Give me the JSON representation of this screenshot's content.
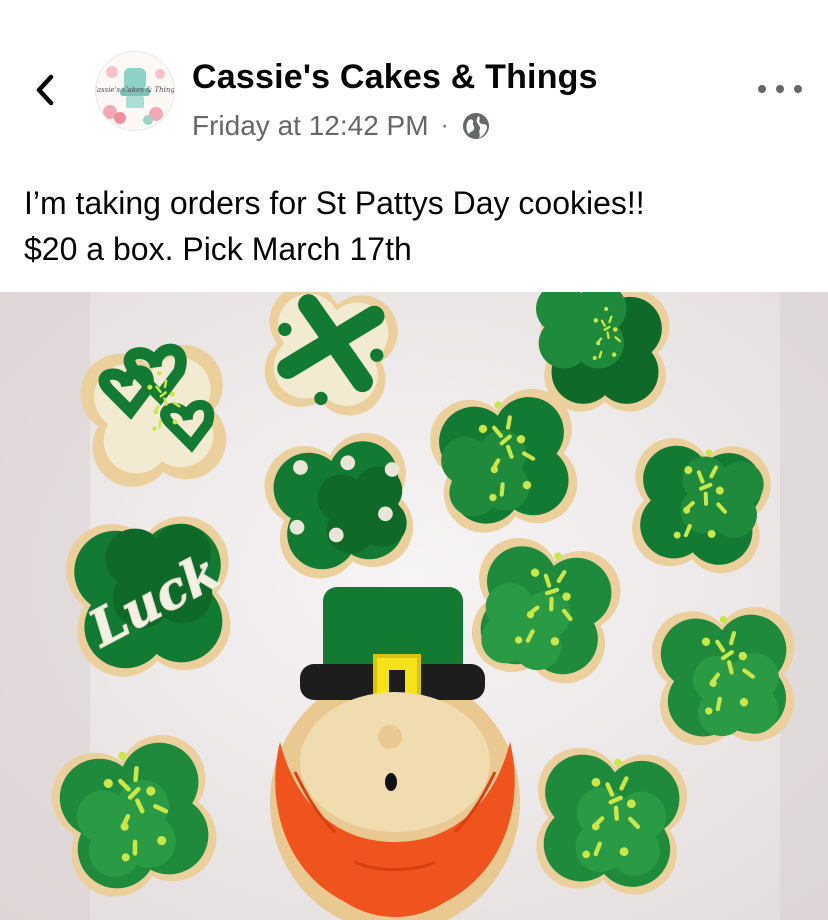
{
  "post": {
    "page_name": "Cassie's Cakes & Things",
    "timestamp": "Friday at 12:42 PM",
    "separator": "·",
    "audience_icon": "globe-icon",
    "text_lines": [
      "I’m taking orders for St Pattys Day cookies!!",
      "$20 a box. Pick March 17th"
    ],
    "avatar_text": "Cassie's Cakes & Things"
  },
  "photo": {
    "cookie_text": "Luck"
  },
  "colors": {
    "text_primary": "#050505",
    "text_secondary": "#65676b",
    "icing_green": "#1f8a3b",
    "icing_dark_green": "#0f6a2a",
    "sprinkle_yellow": "#c9e64a",
    "cookie_tan": "#e9c892",
    "beard_orange": "#f0541e",
    "box_white": "#f4f1f2"
  }
}
